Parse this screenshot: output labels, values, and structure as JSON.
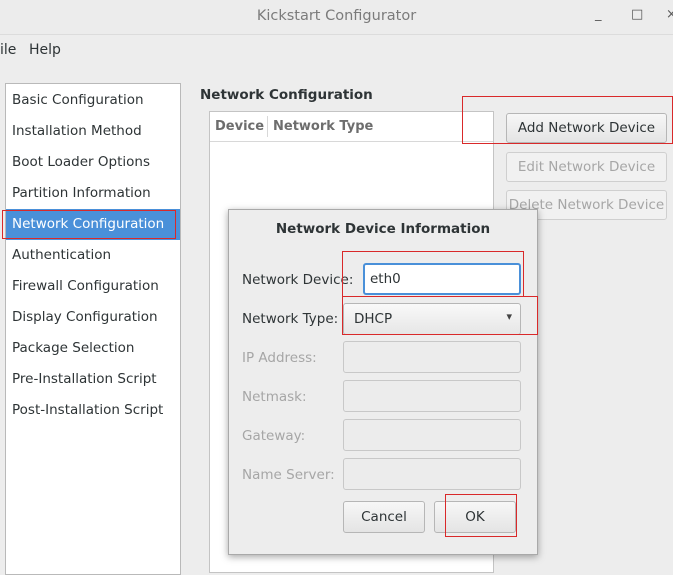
{
  "window": {
    "title": "Kickstart Configurator",
    "minimize_glyph": "_",
    "maximize_glyph": "□",
    "close_glyph": "×"
  },
  "menubar": {
    "file": "ile",
    "help": "Help"
  },
  "sidebar": {
    "items": [
      {
        "label": "Basic Configuration"
      },
      {
        "label": "Installation Method"
      },
      {
        "label": "Boot Loader Options"
      },
      {
        "label": "Partition Information"
      },
      {
        "label": "Network Configuration",
        "selected": true
      },
      {
        "label": "Authentication"
      },
      {
        "label": "Firewall Configuration"
      },
      {
        "label": "Display Configuration"
      },
      {
        "label": "Package Selection"
      },
      {
        "label": "Pre-Installation Script"
      },
      {
        "label": "Post-Installation Script"
      }
    ]
  },
  "main": {
    "section_title": "Network Configuration",
    "table": {
      "columns": [
        "Device",
        "Network Type"
      ],
      "rows": []
    },
    "buttons": {
      "add": "Add Network Device",
      "edit": "Edit Network Device",
      "delete": "Delete Network Device"
    }
  },
  "dialog": {
    "title": "Network Device Information",
    "device_label": "Network Device:",
    "device_value": "eth0",
    "type_label": "Network Type:",
    "type_value": "DHCP",
    "ip_label": "IP Address:",
    "netmask_label": "Netmask:",
    "gateway_label": "Gateway:",
    "nameserver_label": "Name Server:",
    "cancel": "Cancel",
    "ok": "OK"
  },
  "colors": {
    "selection": "#4a90d9",
    "highlight": "#d9292a"
  },
  "icons": {
    "combo_arrow": "chevron-down-icon"
  }
}
